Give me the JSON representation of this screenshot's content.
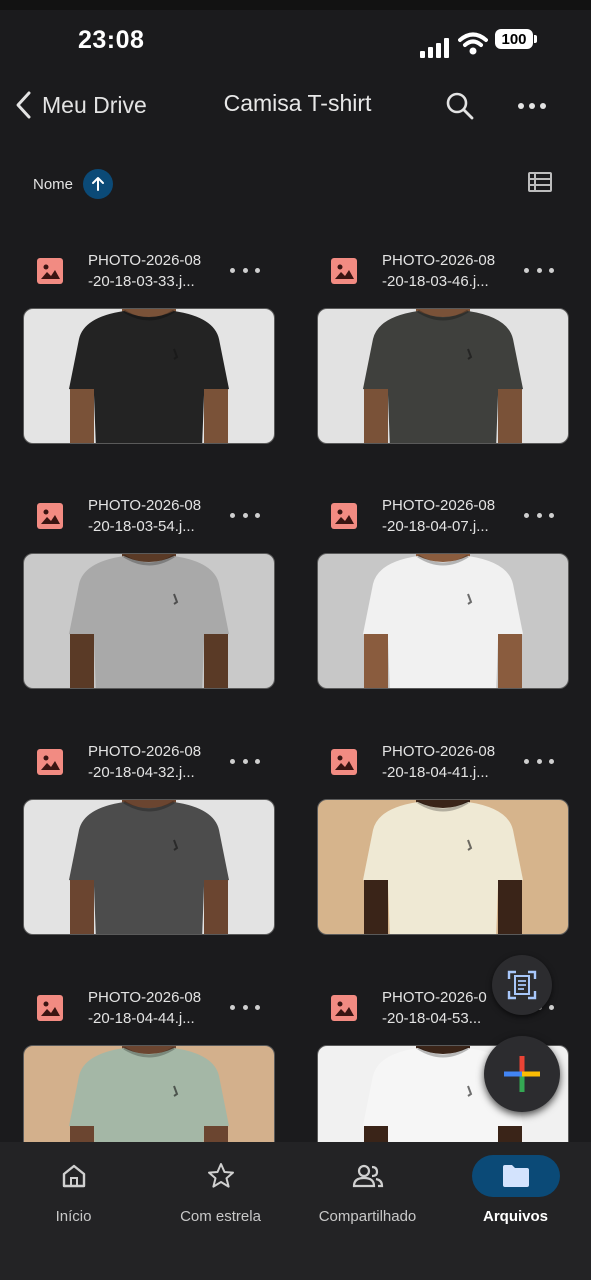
{
  "status_bar": {
    "time": "23:08",
    "battery": "100"
  },
  "header": {
    "back_label": "Meu Drive",
    "title": "Camisa T-shirt"
  },
  "sort": {
    "label": "Nome",
    "direction": "ascending"
  },
  "files": [
    {
      "line1": "PHOTO-2026-08",
      "line2": "-20-18-03-33.j...",
      "shirt_color": "#232323",
      "bg": "#e4e4e4",
      "skin": "#7a5238"
    },
    {
      "line1": "PHOTO-2026-08",
      "line2": "-20-18-03-46.j...",
      "shirt_color": "#3f403d",
      "bg": "#e2e2e2",
      "skin": "#7a5238"
    },
    {
      "line1": "PHOTO-2026-08",
      "line2": "-20-18-03-54.j...",
      "shirt_color": "#a9a9a9",
      "bg": "#c9c9c9",
      "skin": "#5a3a26"
    },
    {
      "line1": "PHOTO-2026-08",
      "line2": "-20-18-04-07.j...",
      "shirt_color": "#f1f1f1",
      "bg": "#c7c7c7",
      "skin": "#8a5c3e"
    },
    {
      "line1": "PHOTO-2026-08",
      "line2": "-20-18-04-32.j...",
      "shirt_color": "#4c4c4c",
      "bg": "#e3e3e3",
      "skin": "#6b4530"
    },
    {
      "line1": "PHOTO-2026-08",
      "line2": "-20-18-04-41.j...",
      "shirt_color": "#efe9d4",
      "bg": "#d6b48c",
      "skin": "#3a2418"
    },
    {
      "line1": "PHOTO-2026-08",
      "line2": "-20-18-04-44.j...",
      "shirt_color": "#a4b7a6",
      "bg": "#d3b08c",
      "skin": "#6b4530"
    },
    {
      "line1": "PHOTO-2026-0",
      "line2": "-20-18-04-53...",
      "shirt_color": "#f6f6f6",
      "bg": "#f1f1f1",
      "skin": "#3a2418"
    }
  ],
  "bottom_nav": [
    {
      "label": "Início",
      "icon": "home-icon"
    },
    {
      "label": "Com estrela",
      "icon": "star-icon"
    },
    {
      "label": "Compartilhado",
      "icon": "people-icon"
    },
    {
      "label": "Arquivos",
      "icon": "folder-icon",
      "active": true
    }
  ],
  "colors": {
    "accent": "#0b4a77",
    "image_icon": "#f28b82",
    "background": "#1b1b1d"
  }
}
